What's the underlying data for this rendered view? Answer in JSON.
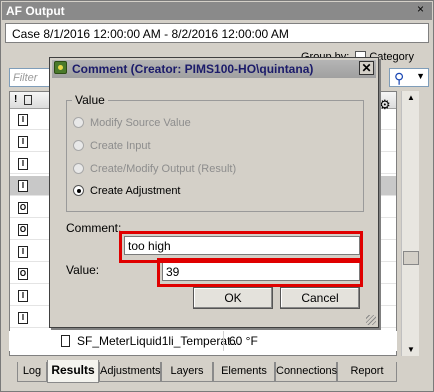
{
  "window": {
    "title": "AF Output",
    "close_glyph": "×"
  },
  "case_selector": {
    "value": "Case 8/1/2016 12:00:00 AM  -  8/2/2016 12:00:00 AM"
  },
  "group_by": {
    "label": "Group by:",
    "option": "Category"
  },
  "filter": {
    "placeholder": "Filter"
  },
  "dialog": {
    "title": "Comment (Creator: PIMS100-HO\\quintana)",
    "close_glyph": "✕",
    "group_label": "Value",
    "options": [
      {
        "label": "Modify Source Value",
        "enabled": false,
        "selected": false
      },
      {
        "label": "Create Input",
        "enabled": false,
        "selected": false
      },
      {
        "label": "Create/Modify Output (Result)",
        "enabled": false,
        "selected": false
      },
      {
        "label": "Create Adjustment",
        "enabled": true,
        "selected": true
      }
    ],
    "comment_label": "Comment:",
    "comment_value": "too high",
    "value_label": "Value:",
    "value_value": "39",
    "ok_label": "OK",
    "cancel_label": "Cancel"
  },
  "grid": {
    "visible_row": {
      "name": "SF_MeterLiquid1li_Temperat...",
      "value": "60 °F"
    }
  },
  "tabs": [
    {
      "label": "Log",
      "active": false
    },
    {
      "label": "Results",
      "active": true
    },
    {
      "label": "Adjustments",
      "active": false
    },
    {
      "label": "Layers",
      "active": false
    },
    {
      "label": "Elements",
      "active": false
    },
    {
      "label": "Connections",
      "active": false
    },
    {
      "label": "Report",
      "active": false
    }
  ],
  "colors": {
    "highlight": "#e00000",
    "dialog_title_text": "#1b1b6a"
  }
}
